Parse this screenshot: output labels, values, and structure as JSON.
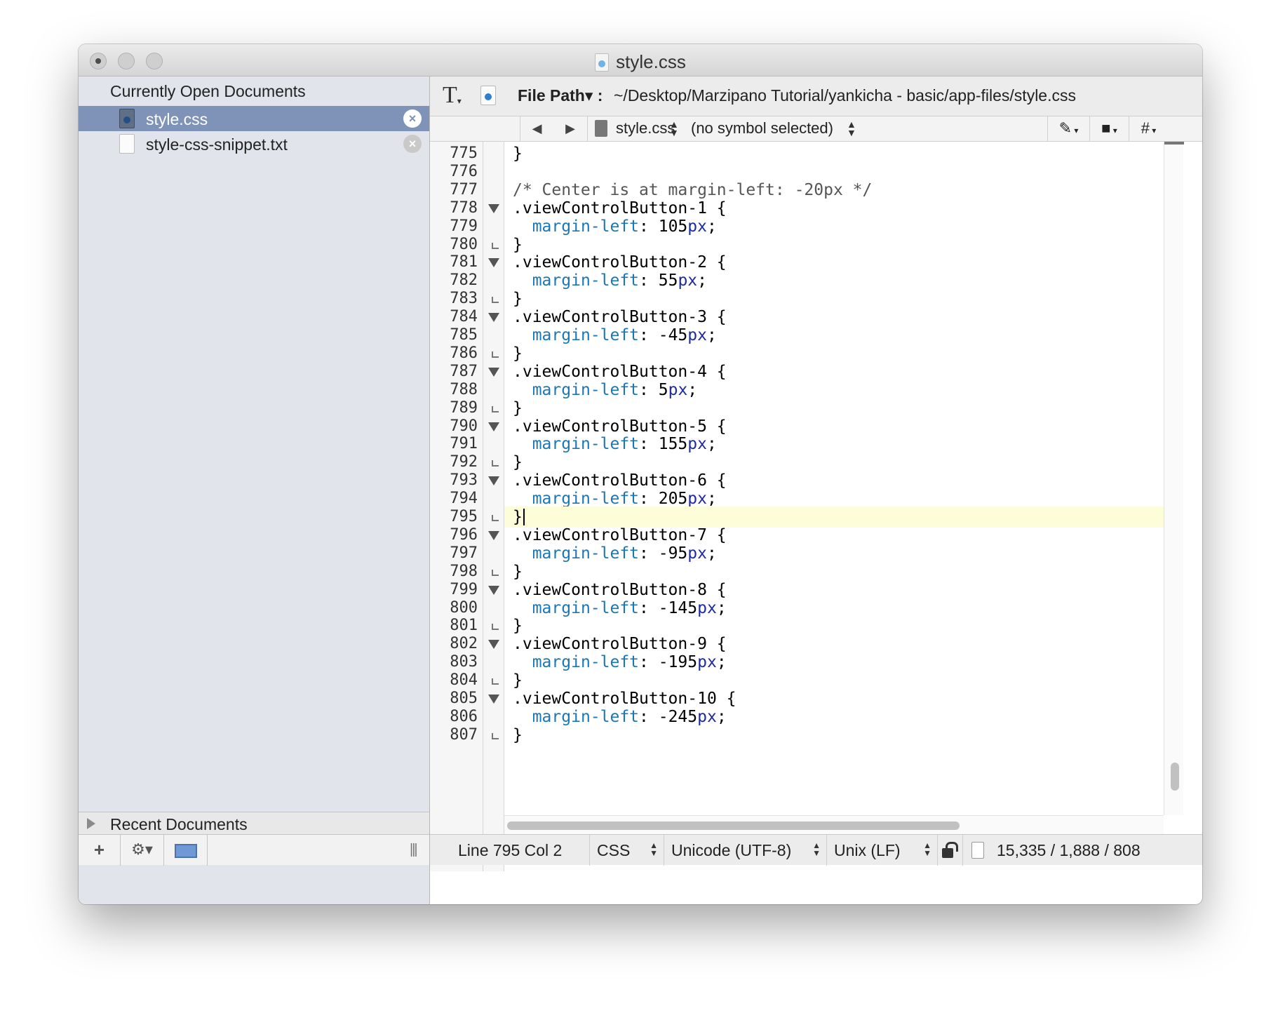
{
  "window": {
    "title": "style.css"
  },
  "sidebar": {
    "header": "Currently Open Documents",
    "items": [
      {
        "label": "style.css",
        "selected": true
      },
      {
        "label": "style-css-snippet.txt",
        "selected": false
      }
    ],
    "recent_label": "Recent Documents",
    "bottom": {
      "add_icon": "+",
      "gear_icon": "⚙▾",
      "grip": "|||"
    }
  },
  "pathbar": {
    "label": "File Path",
    "label_suffix": "▾ :",
    "path": "~/Desktop/Marzipano Tutorial/yankicha - basic/app-files/style.css",
    "text_tool_icon": "T"
  },
  "navbar": {
    "back_icon": "◀",
    "forward_icon": "▶",
    "file": "style.css",
    "symbol": "(no symbol selected)",
    "pen_icon": "✎",
    "square_icon": "■",
    "hash_icon": "#"
  },
  "code": {
    "current_line": 795,
    "lines": [
      {
        "n": "775",
        "fold": "",
        "text": "}"
      },
      {
        "n": "776",
        "fold": "",
        "text": ""
      },
      {
        "n": "777",
        "fold": "",
        "text": "/* Center is at margin-left: -20px */",
        "kind": "comment"
      },
      {
        "n": "778",
        "fold": "open",
        "text": ".viewControlButton-1 {"
      },
      {
        "n": "779",
        "fold": "",
        "prop": "margin-left",
        "num": "105",
        "unit": "px"
      },
      {
        "n": "780",
        "fold": "close",
        "text": "}"
      },
      {
        "n": "781",
        "fold": "open",
        "text": ".viewControlButton-2 {"
      },
      {
        "n": "782",
        "fold": "",
        "prop": "margin-left",
        "num": "55",
        "unit": "px"
      },
      {
        "n": "783",
        "fold": "close",
        "text": "}"
      },
      {
        "n": "784",
        "fold": "open",
        "text": ".viewControlButton-3 {"
      },
      {
        "n": "785",
        "fold": "",
        "prop": "margin-left",
        "num": "-45",
        "unit": "px"
      },
      {
        "n": "786",
        "fold": "close",
        "text": "}"
      },
      {
        "n": "787",
        "fold": "open",
        "text": ".viewControlButton-4 {"
      },
      {
        "n": "788",
        "fold": "",
        "prop": "margin-left",
        "num": "5",
        "unit": "px"
      },
      {
        "n": "789",
        "fold": "close",
        "text": "}"
      },
      {
        "n": "790",
        "fold": "open",
        "text": ".viewControlButton-5 {"
      },
      {
        "n": "791",
        "fold": "",
        "prop": "margin-left",
        "num": "155",
        "unit": "px"
      },
      {
        "n": "792",
        "fold": "close",
        "text": "}"
      },
      {
        "n": "793",
        "fold": "open",
        "text": ".viewControlButton-6 {"
      },
      {
        "n": "794",
        "fold": "",
        "prop": "margin-left",
        "num": "205",
        "unit": "px"
      },
      {
        "n": "795",
        "fold": "close",
        "text": "}"
      },
      {
        "n": "796",
        "fold": "open",
        "text": ".viewControlButton-7 {"
      },
      {
        "n": "797",
        "fold": "",
        "prop": "margin-left",
        "num": "-95",
        "unit": "px"
      },
      {
        "n": "798",
        "fold": "close",
        "text": "}"
      },
      {
        "n": "799",
        "fold": "open",
        "text": ".viewControlButton-8 {"
      },
      {
        "n": "800",
        "fold": "",
        "prop": "margin-left",
        "num": "-145",
        "unit": "px"
      },
      {
        "n": "801",
        "fold": "close",
        "text": "}"
      },
      {
        "n": "802",
        "fold": "open",
        "text": ".viewControlButton-9 {"
      },
      {
        "n": "803",
        "fold": "",
        "prop": "margin-left",
        "num": "-195",
        "unit": "px"
      },
      {
        "n": "804",
        "fold": "close",
        "text": "}"
      },
      {
        "n": "805",
        "fold": "open",
        "text": ".viewControlButton-10 {"
      },
      {
        "n": "806",
        "fold": "",
        "prop": "margin-left",
        "num": "-245",
        "unit": "px"
      },
      {
        "n": "807",
        "fold": "close",
        "text": "}"
      }
    ]
  },
  "status": {
    "line_col": "Line 795 Col 2",
    "language": "CSS",
    "encoding": "Unicode (UTF-8)",
    "line_endings": "Unix (LF)",
    "stats": "15,335 / 1,888 / 808"
  },
  "colors": {
    "selection": "#7e93b7",
    "property": "#1d76b4",
    "unit": "#1d2aa5",
    "current_line": "#fefdd9"
  }
}
